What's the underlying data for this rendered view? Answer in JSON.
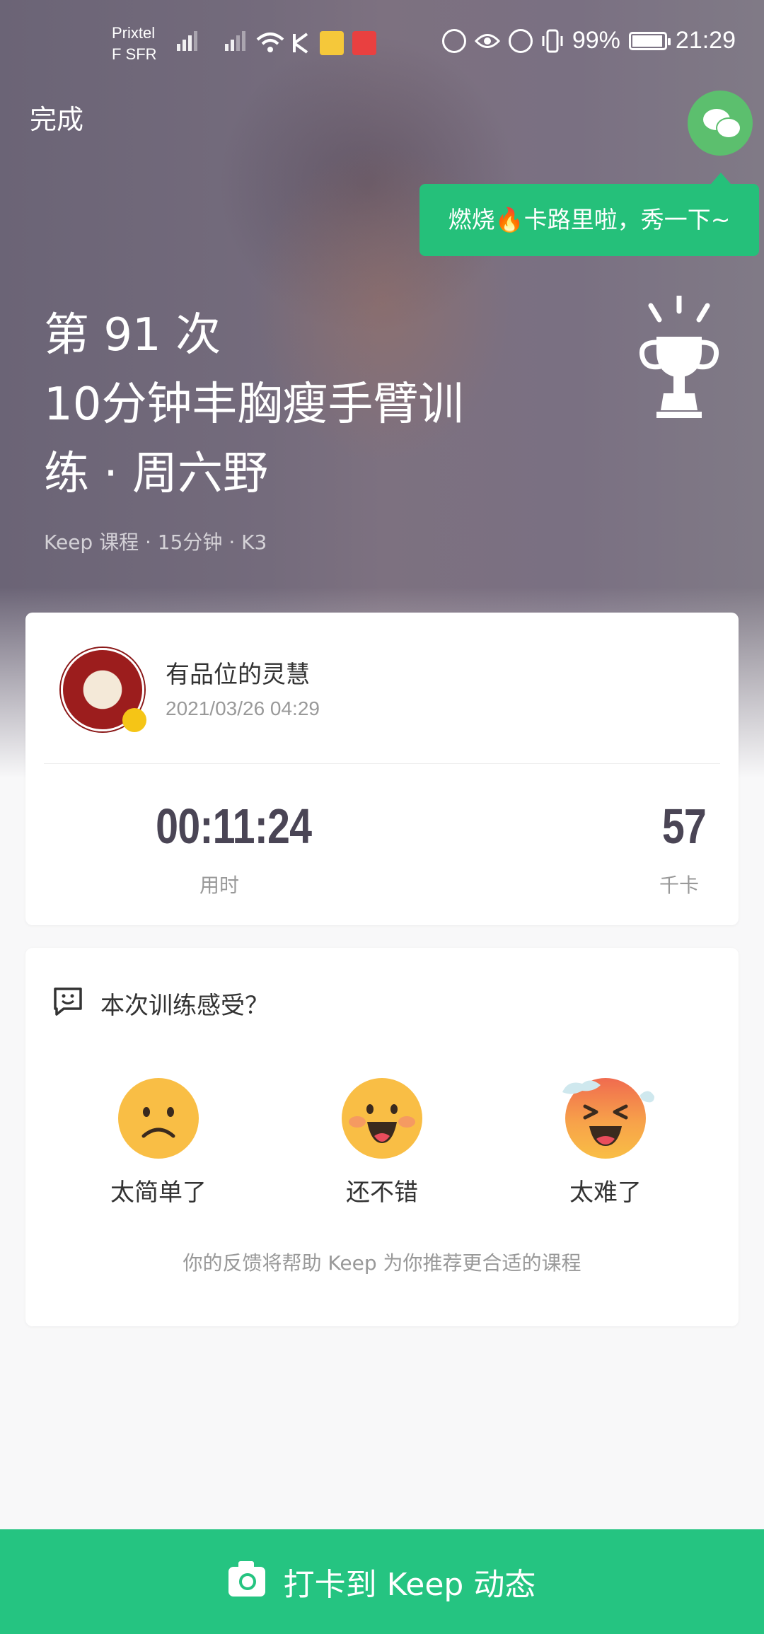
{
  "status_bar": {
    "carrier_line1": "Prixtel",
    "carrier_line2": "F SFR",
    "battery_percent": "99%",
    "time": "21:29",
    "battery_level": 0.99
  },
  "header": {
    "done_label": "完成"
  },
  "share": {
    "tooltip": "燃烧🔥卡路里啦，秀一下~"
  },
  "workout": {
    "count_line": "第 91 次",
    "name_line1": "10分钟丰胸瘦手臂训",
    "name_line2": "练 · 周六野",
    "meta": "Keep 课程 · 15分钟 · K3"
  },
  "user": {
    "name": "有品位的灵慧",
    "datetime": "2021/03/26 04:29"
  },
  "stats": [
    {
      "value": "00:11:24",
      "label": "用时"
    },
    {
      "value": "57",
      "label": "千卡"
    }
  ],
  "feedback": {
    "title": "本次训练感受？",
    "options": [
      {
        "label": "太简单了",
        "icon": "sad-face-icon"
      },
      {
        "label": "还不错",
        "icon": "happy-face-icon"
      },
      {
        "label": "太难了",
        "icon": "sweating-face-icon"
      }
    ],
    "note": "你的反馈将帮助 Keep 为你推荐更合适的课程"
  },
  "bottom": {
    "checkin_label": "打卡到 Keep 动态"
  },
  "colors": {
    "brand_green": "#25c481",
    "emoji_yellow": "#f9be45"
  }
}
